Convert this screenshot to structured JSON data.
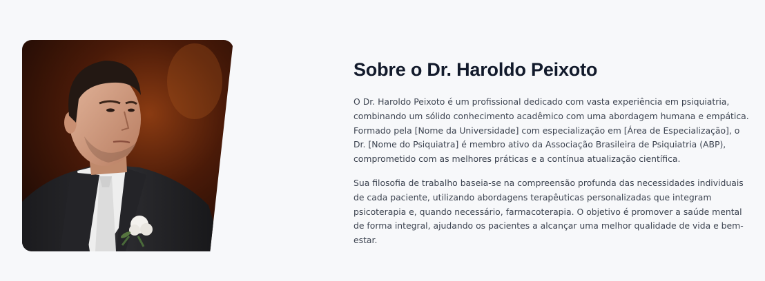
{
  "about": {
    "title": "Sobre o Dr. Haroldo Peixoto",
    "paragraph_1": "O Dr. Haroldo Peixoto é um profissional dedicado com vasta experiência em psiquiatria, combinando um sólido conhecimento acadêmico com uma abordagem humana e empática. Formado pela [Nome da Universidade] com especialização em [Área de Especialização], o Dr. [Nome do Psiquiatra] é membro ativo da Associação Brasileira de Psiquiatria (ABP), comprometido com as melhores práticas e a contínua atualização científica.",
    "paragraph_2": "Sua filosofia de trabalho baseia-se na compreensão profunda das necessidades individuais de cada paciente, utilizando abordagens terapêuticas personalizadas que integram psicoterapia e, quando necessário, farmacoterapia. O objetivo é promover a saúde mental de forma integral, ajudando os pacientes a alcançar uma melhor qualidade de vida e bem-estar."
  },
  "colors": {
    "page_background": "#f7f8fa",
    "title": "#121a2b",
    "body_text": "#3c4350"
  }
}
